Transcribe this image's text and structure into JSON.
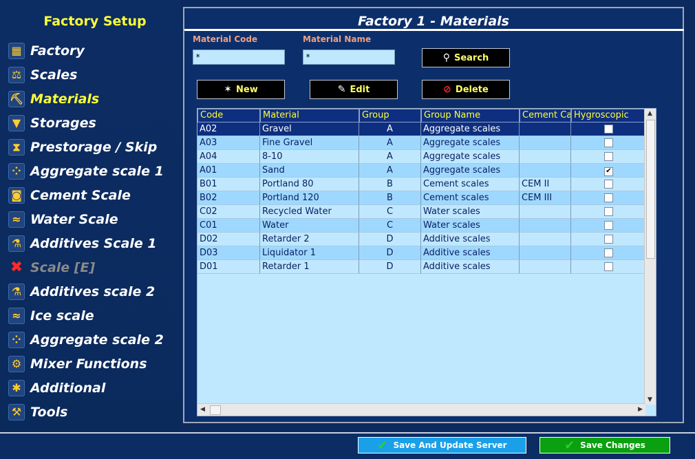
{
  "sidebar": {
    "title": "Factory Setup",
    "items": [
      {
        "label": "Factory",
        "icon": "factory-icon",
        "glyph": "▦"
      },
      {
        "label": "Scales",
        "icon": "scales-icon",
        "glyph": "⚖"
      },
      {
        "label": "Materials",
        "icon": "materials-icon",
        "glyph": "⛏",
        "active": true
      },
      {
        "label": "Storages",
        "icon": "storages-icon",
        "glyph": "▼"
      },
      {
        "label": "Prestorage / Skip",
        "icon": "hourglass-icon",
        "glyph": "⧗"
      },
      {
        "label": "Aggregate scale 1",
        "icon": "aggregate-icon",
        "glyph": "⁘"
      },
      {
        "label": "Cement Scale",
        "icon": "cement-icon",
        "glyph": "◙"
      },
      {
        "label": "Water Scale",
        "icon": "water-icon",
        "glyph": "≈"
      },
      {
        "label": "Additives Scale 1",
        "icon": "additives-icon",
        "glyph": "⚗"
      },
      {
        "label": "Scale [E]",
        "icon": "disabled-x-icon",
        "glyph": "✖",
        "disabled": true
      },
      {
        "label": "Additives scale 2",
        "icon": "additives-icon",
        "glyph": "⚗"
      },
      {
        "label": "Ice scale",
        "icon": "ice-icon",
        "glyph": "≈"
      },
      {
        "label": "Aggregate scale 2",
        "icon": "aggregate-icon",
        "glyph": "⁘"
      },
      {
        "label": "Mixer Functions",
        "icon": "mixer-icon",
        "glyph": "⚙"
      },
      {
        "label": "Additional",
        "icon": "additional-icon",
        "glyph": "✱"
      },
      {
        "label": "Tools",
        "icon": "tools-icon",
        "glyph": "⚒"
      }
    ]
  },
  "panel": {
    "title": "Factory 1 - Materials",
    "filters": {
      "code_label": "Material Code",
      "code_value": "*",
      "name_label": "Material Name",
      "name_value": "*"
    },
    "buttons": {
      "search": "Search",
      "new": "New",
      "edit": "Edit",
      "delete": "Delete"
    },
    "grid": {
      "headers": [
        "Code",
        "Material",
        "Group",
        "Group Name",
        "Cement Ca",
        "Hygroscopic"
      ],
      "rows": [
        {
          "code": "A02",
          "material": "Gravel",
          "group": "A",
          "group_name": "Aggregate scales",
          "cement": "",
          "hygroscopic": false
        },
        {
          "code": "A03",
          "material": "Fine Gravel",
          "group": "A",
          "group_name": "Aggregate scales",
          "cement": "",
          "hygroscopic": false
        },
        {
          "code": "A04",
          "material": "8-10",
          "group": "A",
          "group_name": "Aggregate scales",
          "cement": "",
          "hygroscopic": false
        },
        {
          "code": "A01",
          "material": "Sand",
          "group": "A",
          "group_name": "Aggregate scales",
          "cement": "",
          "hygroscopic": true
        },
        {
          "code": "B01",
          "material": "Portland 80",
          "group": "B",
          "group_name": "Cement scales",
          "cement": "CEM II",
          "hygroscopic": false
        },
        {
          "code": "B02",
          "material": "Portland 120",
          "group": "B",
          "group_name": "Cement scales",
          "cement": "CEM III",
          "hygroscopic": false
        },
        {
          "code": "C02",
          "material": "Recycled Water",
          "group": "C",
          "group_name": "Water scales",
          "cement": "",
          "hygroscopic": false
        },
        {
          "code": "C01",
          "material": "Water",
          "group": "C",
          "group_name": "Water scales",
          "cement": "",
          "hygroscopic": false
        },
        {
          "code": "D02",
          "material": "Retarder 2",
          "group": "D",
          "group_name": "Additive scales",
          "cement": "",
          "hygroscopic": false
        },
        {
          "code": "D03",
          "material": "Liquidator 1",
          "group": "D",
          "group_name": "Additive scales",
          "cement": "",
          "hygroscopic": false
        },
        {
          "code": "D01",
          "material": "Retarder 1",
          "group": "D",
          "group_name": "Additive scales",
          "cement": "",
          "hygroscopic": false
        }
      ],
      "selected_row": 0
    }
  },
  "footer": {
    "save_update_label": "Save And Update Server",
    "save_changes_label": "Save Changes"
  },
  "colors": {
    "background": "#0d2a5e",
    "accent_yellow": "#ffff33",
    "save_update_bg": "#1aa0e8",
    "save_changes_bg": "#0aa010"
  }
}
